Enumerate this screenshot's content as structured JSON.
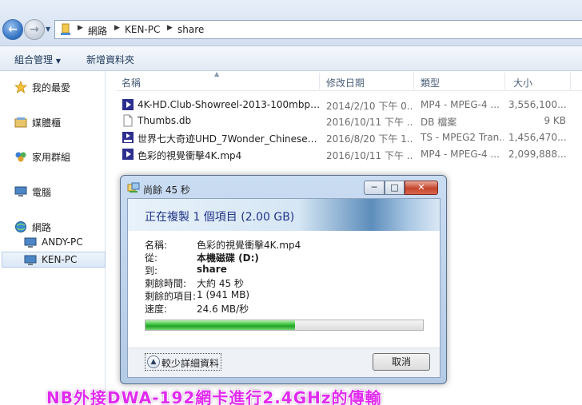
{
  "address": {
    "crumbs": [
      "網路",
      "KEN-PC",
      "share"
    ]
  },
  "toolbar": {
    "organize": "組合管理",
    "new_folder": "新增資料夾"
  },
  "nav": {
    "favorites": "我的最愛",
    "libraries": "媒體櫃",
    "homegroup": "家用群組",
    "computer": "電腦",
    "network": "網路",
    "andy_pc": "ANDY-PC",
    "ken_pc": "KEN-PC"
  },
  "columns": {
    "name": "名稱",
    "date": "修改日期",
    "type": "類型",
    "size": "大小"
  },
  "files": [
    {
      "name": "4K-HD.Club-Showreel-2013-100mbps....",
      "date": "2014/2/10 下午 0...",
      "type": "MP4 - MPEG-4 ...",
      "size": "3,556,100...",
      "icon": "mp4-video-icon"
    },
    {
      "name": "Thumbs.db",
      "date": "2016/10/11 下午 ...",
      "type": "DB 檔案",
      "size": "9 KB",
      "icon": "db-file-icon"
    },
    {
      "name": "世界七大奇迹UHD_7Wonder_Chinese_...",
      "date": "2016/8/20 下午 1...",
      "type": "TS - MPEG2 Tran...",
      "size": "1,456,470...",
      "icon": "ts-video-icon"
    },
    {
      "name": "色彩的視覺衝擊4K.mp4",
      "date": "2016/10/11 下午 ...",
      "type": "MP4 - MPEG-4 ...",
      "size": "2,099,888...",
      "icon": "mp4-video-icon"
    }
  ],
  "dialog": {
    "title": "尚餘 45 秒",
    "heading": "正在複製 1 個項目 (2.00 GB)",
    "rows": [
      {
        "key": "名稱:",
        "value": "色彩的視覺衝擊4K.mp4",
        "bold": false
      },
      {
        "key": "從:",
        "value": "本機磁碟 (D:)",
        "bold": true
      },
      {
        "key": "到:",
        "value": "share",
        "bold": true
      },
      {
        "key": "剩餘時間:",
        "value": "大約 45 秒",
        "bold": false
      },
      {
        "key": "剩餘的項目:",
        "value": "1 (941 MB)",
        "bold": false
      },
      {
        "key": "速度:",
        "value": "24.6 MB/秒",
        "bold": false
      }
    ],
    "progress": 0.54,
    "less_details": "較少詳細資料",
    "cancel": "取消"
  },
  "caption": "NB外接DWA-192網卡進行2.4GHz的傳輸",
  "colors": {
    "caption": "#e12af0",
    "heading": "#1e3287",
    "progress": "#23a328"
  }
}
